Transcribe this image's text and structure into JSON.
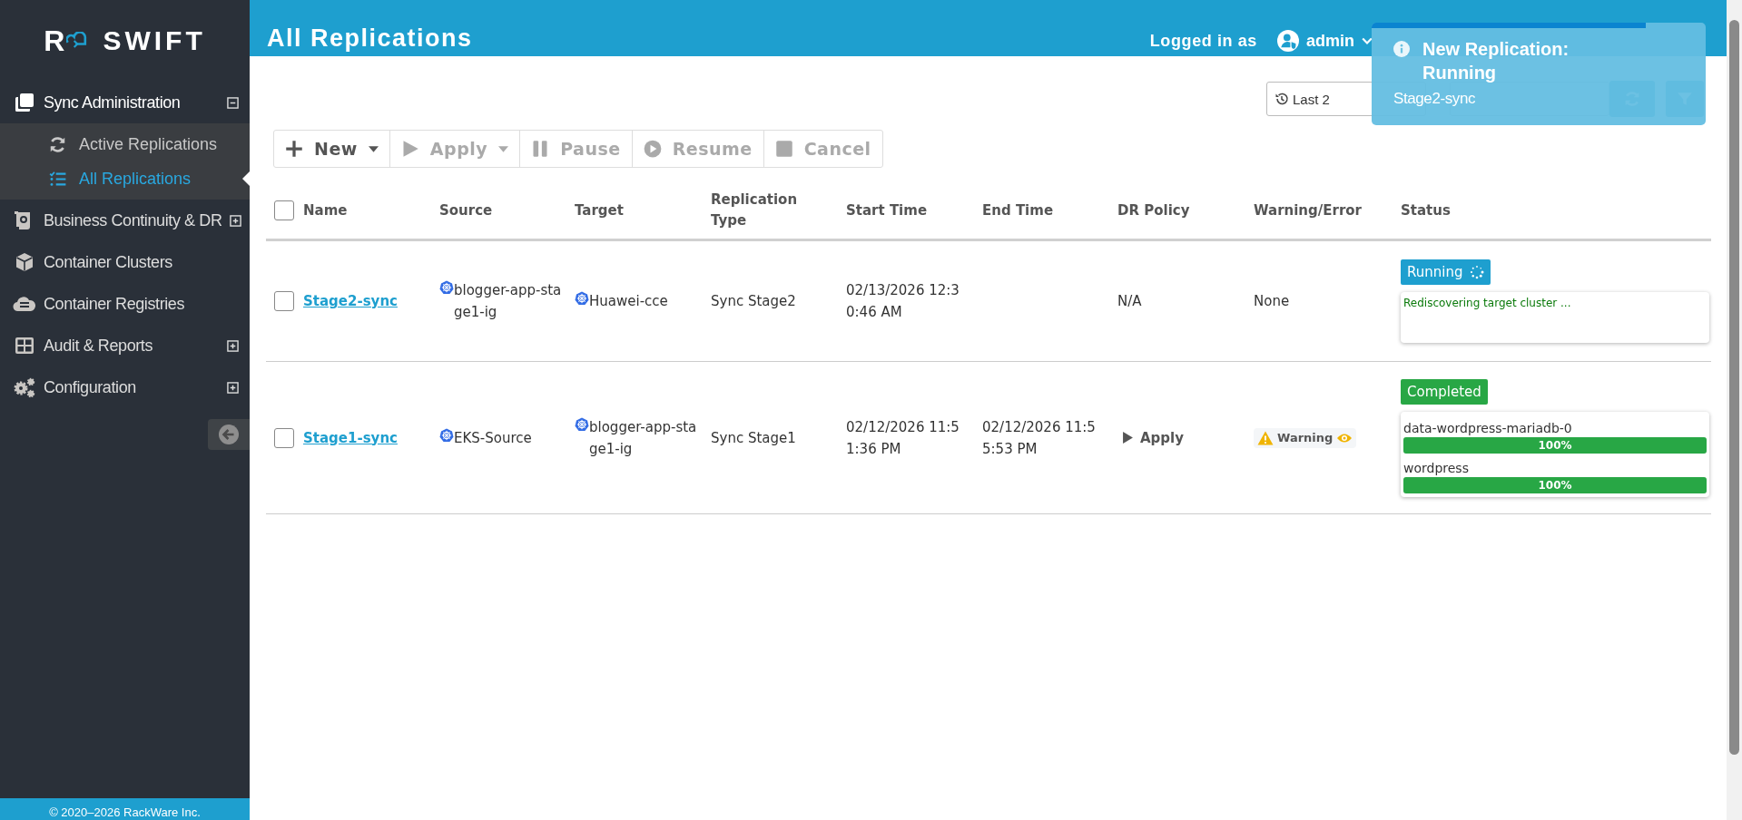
{
  "logo": {
    "mark": "R",
    "name": "SWIFT"
  },
  "sidebar": {
    "items": [
      {
        "label": "Sync Administration",
        "expandable": true,
        "expanded": true,
        "children": [
          {
            "label": "Active Replications",
            "selected": false
          },
          {
            "label": "All Replications",
            "selected": true
          }
        ]
      },
      {
        "label": "Business Continuity & DR",
        "expandable": true,
        "expanded": false
      },
      {
        "label": "Container Clusters",
        "expandable": false
      },
      {
        "label": "Container Registries",
        "expandable": false
      },
      {
        "label": "Audit & Reports",
        "expandable": true,
        "expanded": false
      },
      {
        "label": "Configuration",
        "expandable": true,
        "expanded": false
      }
    ],
    "footer": "© 2020–2026 RackWare Inc."
  },
  "header": {
    "title": "All Replications",
    "user_label": "Logged in as",
    "user": "admin"
  },
  "filters": {
    "range": "Last 2"
  },
  "toolbar": [
    {
      "label": "New",
      "dropdown": true,
      "disabled": false
    },
    {
      "label": "Apply",
      "dropdown": true,
      "disabled": true
    },
    {
      "label": "Pause",
      "dropdown": false,
      "disabled": true
    },
    {
      "label": "Resume",
      "dropdown": false,
      "disabled": true
    },
    {
      "label": "Cancel",
      "dropdown": false,
      "disabled": true
    }
  ],
  "table": {
    "select_all": {
      "checked": false
    },
    "columns": [
      "Name",
      "Source",
      "Target",
      "Replication Type",
      "Start Time",
      "End Time",
      "DR Policy",
      "Warning/Error",
      "Status"
    ],
    "rows": [
      {
        "checked": false,
        "name": "Stage2-sync",
        "source": "blogger-app-stage1-ig",
        "target": "Huawei-cce",
        "type": "Sync Stage2",
        "start_time": "02/13/2026 12:30:46 AM",
        "dr_policy": {
          "kind": "text",
          "text": "N/A"
        },
        "warning": {
          "kind": "text",
          "text": "None"
        },
        "status": {
          "label": "Running",
          "color": "#1e9fcf",
          "spinner": true
        },
        "details": {
          "kind": "message",
          "text": "Rediscovering target cluster ..."
        }
      },
      {
        "checked": false,
        "name": "Stage1-sync",
        "source": "EKS-Source",
        "target": "blogger-app-stage1-ig",
        "type": "Sync Stage1",
        "start_time": "02/12/2026 11:51:36 PM",
        "end_time": "02/12/2026 11:55:53 PM",
        "dr_policy": {
          "kind": "action",
          "text": "Apply"
        },
        "warning": {
          "kind": "warning",
          "text": "Warning"
        },
        "status": {
          "label": "Completed",
          "color": "#28a745",
          "spinner": false
        },
        "details": {
          "kind": "volumes",
          "volumes": [
            {
              "name": "data-wordpress-mariadb-0",
              "level": 1,
              "reading": "100%"
            },
            {
              "name": "wordpress",
              "level": 1,
              "reading": "100%"
            }
          ]
        }
      }
    ]
  },
  "toast": {
    "title": "New Replication: Running",
    "message": "Stage2-sync",
    "level": 0.82
  }
}
